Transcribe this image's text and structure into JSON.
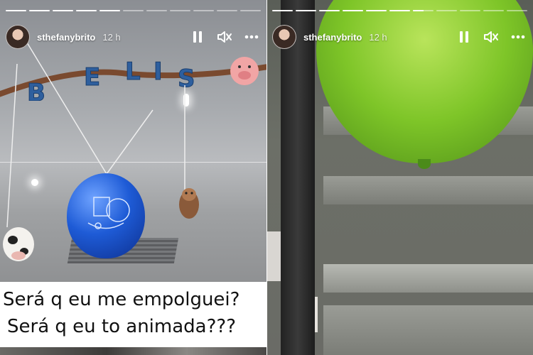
{
  "stories": [
    {
      "username": "sthefanybrito",
      "time": "12 h",
      "progress_filled": [
        1,
        1,
        1,
        1,
        1,
        0,
        0,
        0,
        0,
        0,
        0
      ],
      "caption_lines": [
        "Será q eu me empolguei?",
        "Será q eu to animada???"
      ],
      "banner_letters": [
        "B",
        "E",
        "L",
        "I",
        "S"
      ]
    },
    {
      "username": "sthefanybrito",
      "time": "12 h",
      "progress_filled": [
        1,
        1,
        1,
        1,
        1,
        1,
        0.5,
        0,
        0,
        0,
        0
      ],
      "caption_lines": []
    }
  ],
  "icons": {
    "pause": "pause-icon",
    "mute": "speaker-muted-icon",
    "more": "more-horizontal-icon"
  },
  "colors": {
    "balloon_blue": "#1e5bd6",
    "balloon_green": "#7ec528",
    "banner_brown": "#7a4a2f"
  }
}
